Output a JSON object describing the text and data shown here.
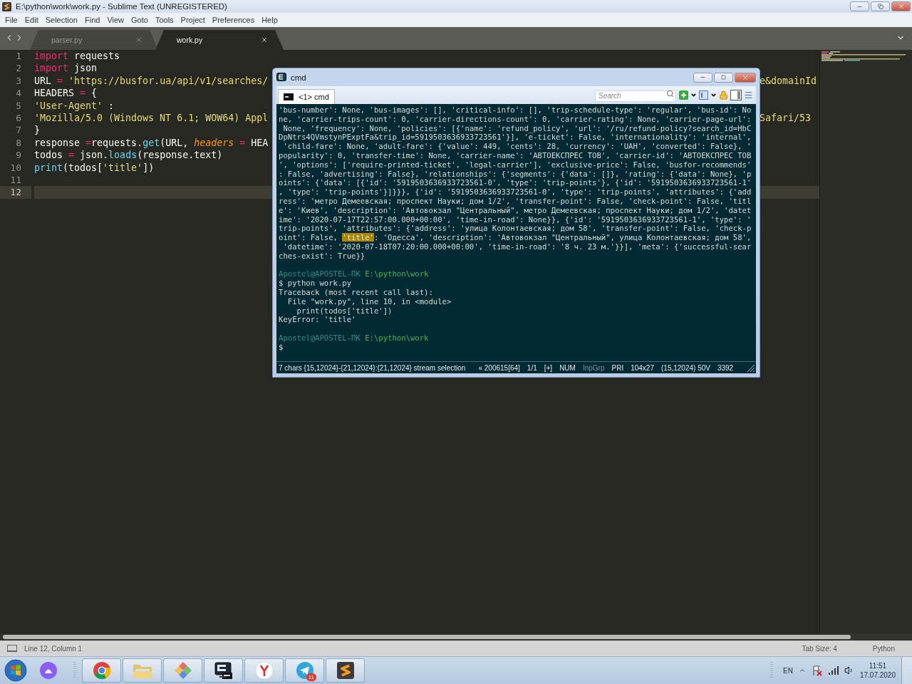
{
  "window": {
    "title": "E:\\python\\work\\work.py - Sublime Text (UNREGISTERED)"
  },
  "menu": [
    "File",
    "Edit",
    "Selection",
    "Find",
    "View",
    "Goto",
    "Tools",
    "Project",
    "Preferences",
    "Help"
  ],
  "tabs": [
    {
      "label": "parser.py",
      "selected": false
    },
    {
      "label": "work.py",
      "selected": true
    }
  ],
  "editor": {
    "lines": [
      {
        "number": "1",
        "current": false,
        "tokens": [
          {
            "text": "import",
            "kind": "keyword"
          },
          {
            "text": " requests",
            "kind": "plain"
          }
        ]
      },
      {
        "number": "2",
        "current": false,
        "tokens": [
          {
            "text": "import",
            "kind": "keyword"
          },
          {
            "text": " json",
            "kind": "plain"
          }
        ]
      },
      {
        "number": "3",
        "current": false,
        "tokens": [
          {
            "text": "URL ",
            "kind": "plain"
          },
          {
            "text": "=",
            "kind": "operator"
          },
          {
            "text": " 'https://busfor.ua/api/v1/searches/",
            "kind": "string"
          }
        ],
        "fragment": {
          "text": "e&domainId",
          "kind": "string"
        }
      },
      {
        "number": "4",
        "current": false,
        "tokens": [
          {
            "text": "HEADERS ",
            "kind": "plain"
          },
          {
            "text": "=",
            "kind": "operator"
          },
          {
            "text": " {",
            "kind": "plain"
          }
        ]
      },
      {
        "number": "5",
        "current": false,
        "tokens": [
          {
            "text": "'User-Agent'",
            "kind": "string"
          },
          {
            "text": " :",
            "kind": "plain"
          }
        ]
      },
      {
        "number": "6",
        "current": false,
        "tokens": [
          {
            "text": "'Mozilla/5.0 (Windows NT 6.1; WOW64) Appl",
            "kind": "string"
          }
        ],
        "fragment": {
          "text": "Safari/53",
          "kind": "string"
        }
      },
      {
        "number": "7",
        "current": false,
        "tokens": [
          {
            "text": "}",
            "kind": "plain"
          }
        ]
      },
      {
        "number": "8",
        "current": false,
        "tokens": [
          {
            "text": "response ",
            "kind": "plain"
          },
          {
            "text": "=",
            "kind": "operator"
          },
          {
            "text": "requests.",
            "kind": "plain"
          },
          {
            "text": "get",
            "kind": "func"
          },
          {
            "text": "(URL, ",
            "kind": "plain"
          },
          {
            "text": "headers",
            "kind": "param"
          },
          {
            "text": " =",
            "kind": "operator"
          },
          {
            "text": " HEA",
            "kind": "plain"
          }
        ]
      },
      {
        "number": "9",
        "current": false,
        "tokens": [
          {
            "text": "todos ",
            "kind": "plain"
          },
          {
            "text": "=",
            "kind": "operator"
          },
          {
            "text": " json.",
            "kind": "plain"
          },
          {
            "text": "loads",
            "kind": "func"
          },
          {
            "text": "(response.text)",
            "kind": "plain"
          }
        ]
      },
      {
        "number": "10",
        "current": false,
        "tokens": [
          {
            "text": "print",
            "kind": "func"
          },
          {
            "text": "(todos[",
            "kind": "plain"
          },
          {
            "text": "'title'",
            "kind": "string"
          },
          {
            "text": "])",
            "kind": "plain"
          }
        ]
      },
      {
        "number": "11",
        "current": false
      },
      {
        "number": "12",
        "current": true
      }
    ]
  },
  "status_bar": {
    "position": "Line 12, Column 1",
    "tab_size": "Tab Size: 4",
    "syntax": "Python"
  },
  "terminal": {
    "title": "cmd",
    "tab": {
      "label": "<1> cmd",
      "selected": true
    },
    "search": {
      "placeholder": "Search"
    },
    "blocks": [
      [
        [
          {
            "text": "'bus-number': None, 'bus-images': [], 'critical-info': [], 'trip-schedule-type': 'regular', 'bus-id': No",
            "kind": "text"
          }
        ],
        [
          {
            "text": "ne, 'carrier-trips-count': 0, 'carrier-directions-count': 0, 'carrier-rating': None, 'carrier-page-url':",
            "kind": "text"
          }
        ],
        [
          {
            "text": " None, 'frequency': None, 'policies': [{'name': 'refund_policy', 'url': '/ru/refund-policy?search_id=HbC",
            "kind": "text"
          }
        ],
        [
          {
            "text": "DpNtrs4QVmstynPExptFa&trip_id=5919503636933723561'}], 'e-ticket': False, 'internationality': 'internal',",
            "kind": "text"
          }
        ],
        [
          {
            "text": " 'child-fare': None, 'adult-fare': {'value': 449, 'cents': 28, 'currency': 'UAH', 'converted': False}, '",
            "kind": "text"
          }
        ],
        [
          {
            "text": "popularity': 0, 'transfer-time': None, 'carrier-name': 'АВТОЕКСПРЕС ТОВ', 'carrier-id': 'АВТОЕКСПРЕС ТОВ",
            "kind": "text"
          }
        ],
        [
          {
            "text": "', 'options': ['require-printed-ticket', 'legal-carrier'], 'exclusive-price': False, 'busfor-recommends'",
            "kind": "text"
          }
        ],
        [
          {
            "text": ": False, 'advertising': False}, 'relationships': {'segments': {'data': []}, 'rating': {'data': None}, 'p",
            "kind": "text"
          }
        ],
        [
          {
            "text": "oints': {'data': [{'id': '5919503636933723561-0', 'type': 'trip-points'}, {'id': '5919503636933723561-1'",
            "kind": "text"
          }
        ],
        [
          {
            "text": ", 'type': 'trip-points'}]}}}, {'id': '5919503636933723561-0', 'type': 'trip-points', 'attributes': {'add",
            "kind": "text"
          }
        ],
        [
          {
            "text": "ress': 'метро Демеевская; проспект Науки; дом 1/2', 'transfer-point': False, 'check-point': False, 'titl",
            "kind": "text"
          }
        ],
        [
          {
            "text": "e': 'Киев', 'description': 'Автовокзал \"Центральный\", метро Демеевская; проспект Науки; дом 1/2', 'datet",
            "kind": "text"
          }
        ],
        [
          {
            "text": "ime': '2020-07-17T22:57:00.000+00:00', 'time-in-road': None}}, {'id': '5919503636933723561-1', 'type': '",
            "kind": "text"
          }
        ],
        [
          {
            "text": "trip-points', 'attributes': {'address': 'улица Колонтаевская; дом 58', 'transfer-point': False, 'check-p",
            "kind": "text"
          }
        ],
        [
          {
            "text": "oint': False, ",
            "kind": "text"
          },
          {
            "text": "'title'",
            "kind": "match"
          },
          {
            "text": ": 'Одесса', 'description': 'Автовокзал \"Центральный\", улица Колонтаевская; дом 58',",
            "kind": "text"
          }
        ],
        [
          {
            "text": " 'datetime': '2020-07-18T07:20:00.000+00:00', 'time-in-road': '8 ч. 23 м.'}}], 'meta': {'successful-sear",
            "kind": "text"
          }
        ],
        [
          {
            "text": "ches-exist': True}}",
            "kind": "text"
          }
        ]
      ],
      [
        [
          {
            "text": "Apostel@APOSTEL-ПК",
            "kind": "user"
          },
          {
            "text": "E:\\python\\work",
            "kind": "path"
          }
        ],
        [
          {
            "text": "$ python work.py",
            "kind": "text"
          }
        ],
        [
          {
            "text": "Traceback (most recent call last):",
            "kind": "text"
          }
        ],
        [
          {
            "text": "  File \"work.py\", line 10, in <module>",
            "kind": "text"
          }
        ],
        [
          {
            "text": "    print(todos['title'])",
            "kind": "text"
          }
        ],
        [
          {
            "text": "KeyError: 'title'",
            "kind": "text"
          }
        ]
      ],
      [
        [
          {
            "text": "Apostel@APOSTEL-ПК",
            "kind": "user"
          },
          {
            "text": "E:\\python\\work",
            "kind": "path"
          }
        ],
        [
          {
            "text": "$",
            "kind": "text"
          }
        ]
      ]
    ],
    "status": [
      {
        "text": "7 chars {15,12024}-{21,12024}:{21,12024} stream selection",
        "enabled": true
      },
      {
        "text": "« 200615[64]",
        "enabled": true
      },
      {
        "text": "1/1",
        "enabled": true
      },
      {
        "text": "[+]",
        "enabled": true
      },
      {
        "text": "NUM",
        "enabled": true
      },
      {
        "text": "InpGrp",
        "enabled": false
      },
      {
        "text": "PRI",
        "enabled": true
      },
      {
        "text": "104x27",
        "enabled": true
      },
      {
        "text": "(15,12024) 50V",
        "enabled": true
      },
      {
        "text": "3392",
        "enabled": true
      }
    ]
  },
  "taskbar": {
    "apps": [
      {
        "kind": "assistant"
      },
      {
        "kind": "chrome"
      },
      {
        "kind": "folder"
      },
      {
        "kind": "diamond"
      },
      {
        "kind": "terminal"
      },
      {
        "kind": "yandex"
      },
      {
        "kind": "telegram",
        "badge": "11"
      },
      {
        "kind": "sublime"
      }
    ],
    "language": "EN",
    "time": "11:51",
    "date": "17.07.2020"
  }
}
